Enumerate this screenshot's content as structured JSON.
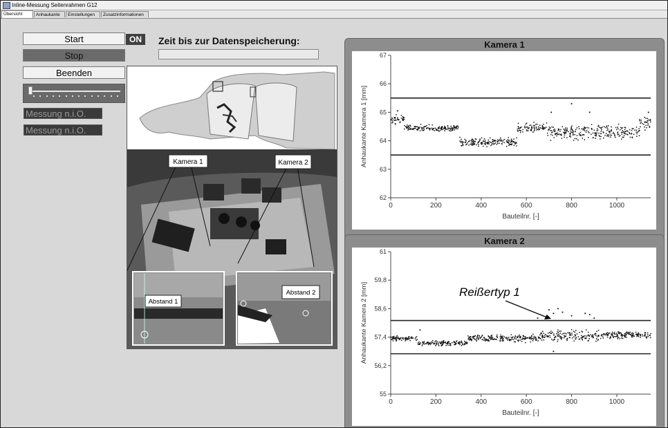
{
  "window": {
    "title": "Inline-Messung Seitenrahmen G12"
  },
  "tabs": [
    {
      "label": "Übersicht",
      "active": true
    },
    {
      "label": "Anhaukante",
      "active": false
    },
    {
      "label": "Einstellungen",
      "active": false
    },
    {
      "label": "Zusatzinformationen",
      "active": false
    }
  ],
  "controls": {
    "start_label": "Start",
    "stop_label": "Stop",
    "beenden_label": "Beenden",
    "on_label": "ON",
    "slider_value": 0.0,
    "messages": [
      "Messung n.i.O.",
      "Messung n.i.O."
    ]
  },
  "storage": {
    "label": "Zeit bis zur Datenspeicherung:",
    "progress": 0.0
  },
  "images": {
    "kamera1_callout": "Kamera 1",
    "kamera2_callout": "Kamera 2",
    "abstand1_label": "Abstand 1",
    "abstand2_label": "Abstand 2"
  },
  "annotation": {
    "text": "Reißertyp 1"
  },
  "colors": {
    "panel_bg": "#8d8d8d",
    "plot_bg": "#ffffff",
    "data_point": "#111111",
    "status_dark": "#3a3a3a"
  },
  "chart_data": [
    {
      "type": "scatter",
      "title": "Kamera 1",
      "xlabel": "Bauteilnr. [-]",
      "ylabel": "Anhaukante Kamera 1 [mm]",
      "xlim": [
        0,
        1150
      ],
      "ylim": [
        62,
        67
      ],
      "xticks": [
        0,
        200,
        400,
        600,
        800,
        1000
      ],
      "yticks": [
        62,
        63,
        64,
        65,
        66,
        67
      ],
      "ytick_labels": [
        "62",
        "63",
        "64",
        "65",
        "66",
        "67"
      ],
      "limit_lines": [
        65.5,
        63.5
      ],
      "segments": [
        {
          "x0": 0,
          "x1": 60,
          "mean": 64.75,
          "spread": 0.25
        },
        {
          "x0": 60,
          "x1": 300,
          "mean": 64.45,
          "spread": 0.15
        },
        {
          "x0": 300,
          "x1": 560,
          "mean": 63.95,
          "spread": 0.2
        },
        {
          "x0": 560,
          "x1": 680,
          "mean": 64.45,
          "spread": 0.25
        },
        {
          "x0": 680,
          "x1": 1100,
          "mean": 64.3,
          "spread": 0.35
        },
        {
          "x0": 1100,
          "x1": 1150,
          "mean": 64.6,
          "spread": 0.35
        }
      ],
      "outliers": [
        {
          "x": 710,
          "y": 65.0
        },
        {
          "x": 800,
          "y": 65.3
        },
        {
          "x": 880,
          "y": 65.0
        },
        {
          "x": 30,
          "y": 65.05
        },
        {
          "x": 1140,
          "y": 65.0
        }
      ]
    },
    {
      "type": "scatter",
      "title": "Kamera 2",
      "xlabel": "Bauteilnr. [-]",
      "ylabel": "Anhaukante Kamera 2 [mm]",
      "xlim": [
        0,
        1150
      ],
      "ylim": [
        55,
        61
      ],
      "xticks": [
        0,
        200,
        400,
        600,
        800,
        1000
      ],
      "yticks": [
        55,
        56.2,
        57.4,
        58.6,
        59.8,
        61
      ],
      "ytick_labels": [
        "55",
        "56,2",
        "57,4",
        "58,6",
        "59,8",
        "61"
      ],
      "limit_lines": [
        58.1,
        56.7
      ],
      "segments": [
        {
          "x0": 0,
          "x1": 120,
          "mean": 57.35,
          "spread": 0.15
        },
        {
          "x0": 120,
          "x1": 340,
          "mean": 57.15,
          "spread": 0.15
        },
        {
          "x0": 340,
          "x1": 660,
          "mean": 57.35,
          "spread": 0.2
        },
        {
          "x0": 660,
          "x1": 920,
          "mean": 57.45,
          "spread": 0.35
        },
        {
          "x0": 920,
          "x1": 1150,
          "mean": 57.5,
          "spread": 0.2
        }
      ],
      "outliers": [
        {
          "x": 700,
          "y": 58.55
        },
        {
          "x": 720,
          "y": 58.4
        },
        {
          "x": 740,
          "y": 58.6
        },
        {
          "x": 690,
          "y": 58.3
        },
        {
          "x": 760,
          "y": 58.45
        },
        {
          "x": 800,
          "y": 58.3
        },
        {
          "x": 860,
          "y": 58.4
        },
        {
          "x": 880,
          "y": 58.35
        },
        {
          "x": 900,
          "y": 58.2
        },
        {
          "x": 650,
          "y": 58.2
        },
        {
          "x": 130,
          "y": 57.7
        },
        {
          "x": 720,
          "y": 56.8
        }
      ]
    }
  ]
}
